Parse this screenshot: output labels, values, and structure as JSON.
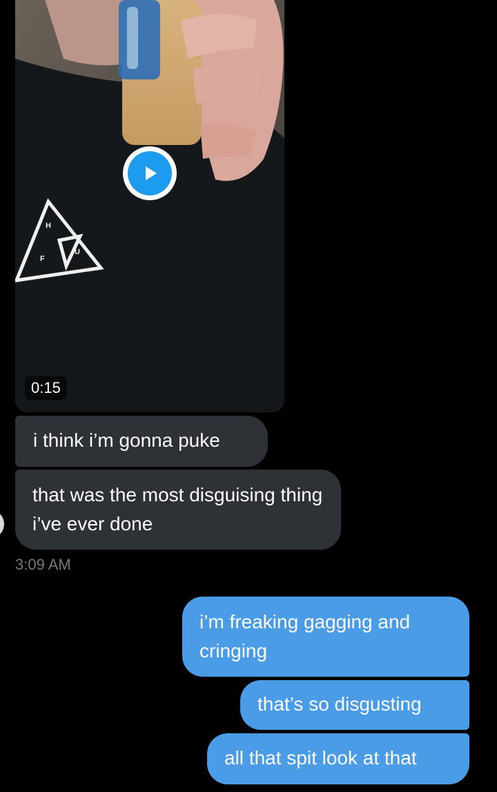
{
  "conversation": {
    "video": {
      "duration": "0:15",
      "play_icon": "play-icon",
      "shirt_logo_letters": [
        "H",
        "F",
        "U"
      ]
    },
    "received": [
      {
        "text": "i think i’m gonna puke"
      },
      {
        "text": "that was the most disguising thing i’ve ever done"
      }
    ],
    "timestamp": "3:09 AM",
    "sent": [
      {
        "text": "i’m freaking gagging and cringing"
      },
      {
        "text": "that’s so disgusting"
      },
      {
        "text": "all that spit look at that"
      }
    ]
  },
  "colors": {
    "background": "#000000",
    "received_bubble": "#2e3236",
    "sent_bubble": "#4a9ce6",
    "play_accent": "#1d9bf0",
    "timestamp": "#74787d"
  }
}
